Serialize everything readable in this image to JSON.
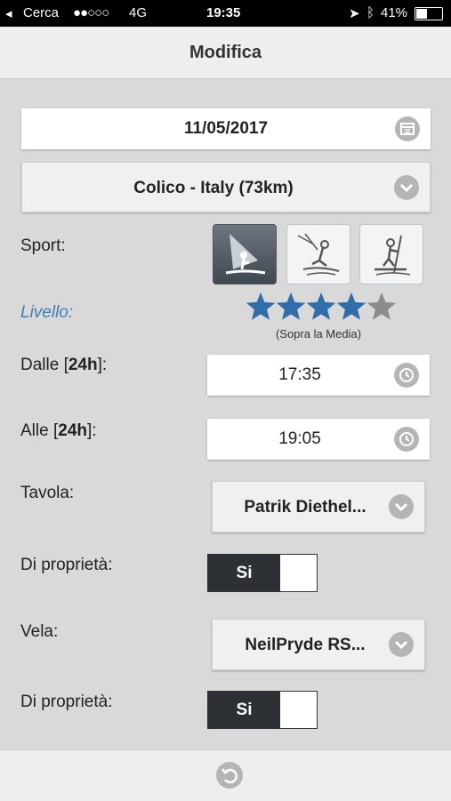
{
  "status_bar": {
    "carrier": "Cerca",
    "signal": "●●○○○",
    "network": "4G",
    "time": "19:35",
    "battery": "41%"
  },
  "header": {
    "title": "Modifica"
  },
  "date_field": {
    "value": "11/05/2017"
  },
  "location_select": {
    "value": "Colico - Italy (73km)"
  },
  "sport": {
    "label": "Sport:",
    "options": [
      "windsurf",
      "kitesurf",
      "sup"
    ],
    "selected": "windsurf"
  },
  "level": {
    "label": "Livello:",
    "stars": 4,
    "max_stars": 5,
    "caption": "(Sopra la Media)"
  },
  "from_time": {
    "label_prefix": "Dalle [",
    "label_bold": "24h",
    "label_suffix": "]:",
    "value": "17:35"
  },
  "to_time": {
    "label_prefix": "Alle [",
    "label_bold": "24h",
    "label_suffix": "]:",
    "value": "19:05"
  },
  "board": {
    "label": "Tavola:",
    "value": "Patrik Diethel..."
  },
  "board_owned": {
    "label": "Di proprietà:",
    "value": "Si"
  },
  "sail": {
    "label": "Vela:",
    "value": "NeilPryde RS..."
  },
  "sail_owned": {
    "label": "Di proprietà:",
    "value": "Si"
  },
  "colors": {
    "accent": "#3f7fb8",
    "star_filled": "#2f6ea8",
    "star_empty": "#8c8c8c"
  }
}
